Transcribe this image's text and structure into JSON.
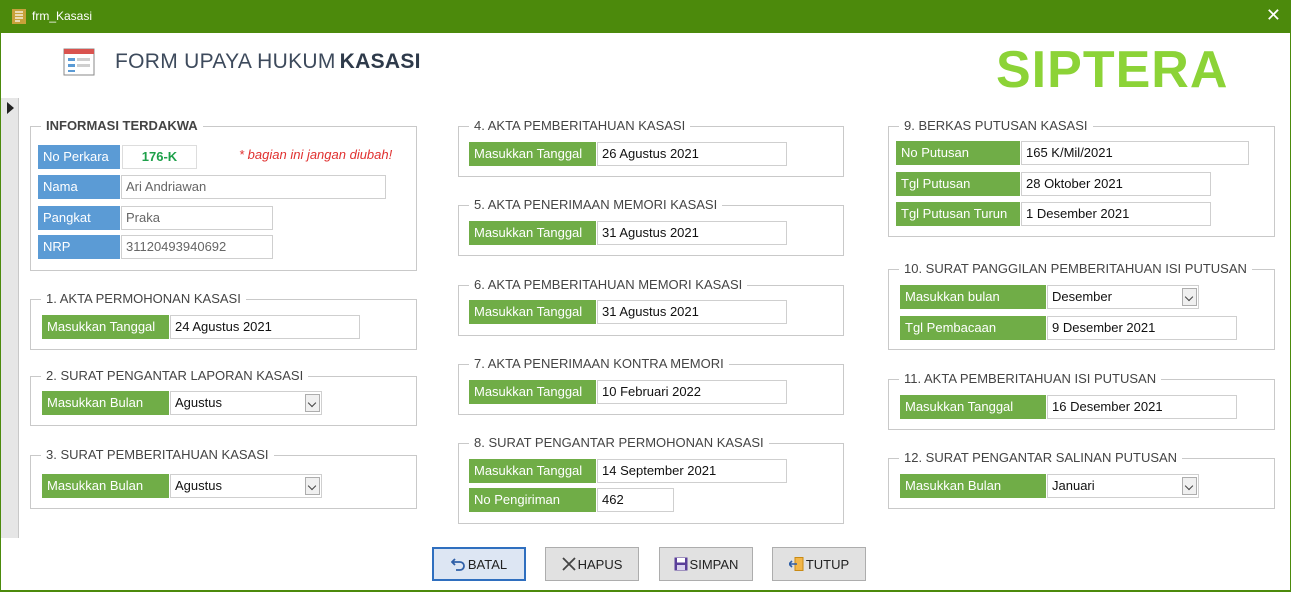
{
  "window": {
    "title": "frm_Kasasi"
  },
  "header": {
    "title_prefix": "FORM UPAYA HUKUM",
    "title_bold": "KASASI",
    "logo": "SIPTERA"
  },
  "terdakwa": {
    "title": "INFORMASI TERDAKWA",
    "note": "* bagian ini jangan diubah!",
    "no_perkara_label": "No Perkara",
    "no_perkara": "176-K",
    "nama_label": "Nama",
    "nama": "Ari Andriawan",
    "pangkat_label": "Pangkat",
    "pangkat": "Praka",
    "nrp_label": "NRP",
    "nrp": "31120493940692"
  },
  "s1": {
    "title": "1. AKTA PERMOHONAN KASASI",
    "label": "Masukkan Tanggal",
    "value": "24 Agustus 2021"
  },
  "s2": {
    "title": "2. SURAT PENGANTAR LAPORAN KASASI",
    "label": "Masukkan Bulan",
    "value": "Agustus"
  },
  "s3": {
    "title": "3. SURAT PEMBERITAHUAN KASASI",
    "label": "Masukkan Bulan",
    "value": "Agustus"
  },
  "s4": {
    "title": "4. AKTA PEMBERITAHUAN KASASI",
    "label": "Masukkan Tanggal",
    "value": "26 Agustus 2021"
  },
  "s5": {
    "title": "5. AKTA PENERIMAAN MEMORI KASASI",
    "label": "Masukkan Tanggal",
    "value": "31 Agustus 2021"
  },
  "s6": {
    "title": "6. AKTA PEMBERITAHUAN MEMORI KASASI",
    "label": "Masukkan Tanggal",
    "value": "31 Agustus 2021"
  },
  "s7": {
    "title": "7. AKTA PENERIMAAN KONTRA MEMORI",
    "label": "Masukkan Tanggal",
    "value": "10 Februari 2022"
  },
  "s8": {
    "title": "8. SURAT PENGANTAR PERMOHONAN KASASI",
    "label": "Masukkan Tanggal",
    "value": "14 September 2021",
    "label2": "No Pengiriman",
    "value2": "462"
  },
  "s9": {
    "title": "9. BERKAS PUTUSAN KASASI",
    "no_label": "No Putusan",
    "no_value": "165 K/Mil/2021",
    "tgl_label": "Tgl Putusan",
    "tgl_value": "28 Oktober 2021",
    "turun_label": "Tgl Putusan Turun",
    "turun_value": "1 Desember 2021"
  },
  "s10": {
    "title": "10. SURAT PANGGILAN PEMBERITAHUAN ISI PUTUSAN",
    "label": "Masukkan bulan",
    "value": "Desember",
    "label2": "Tgl Pembacaan",
    "value2": "9 Desember 2021"
  },
  "s11": {
    "title": "11. AKTA PEMBERITAHUAN ISI PUTUSAN",
    "label": "Masukkan Tanggal",
    "value": "16 Desember 2021"
  },
  "s12": {
    "title": "12. SURAT PENGANTAR SALINAN PUTUSAN",
    "label": "Masukkan Bulan",
    "value": "Januari"
  },
  "buttons": {
    "batal": "BATAL",
    "hapus": "HAPUS",
    "simpan": "SIMPAN",
    "tutup": "TUTUP"
  },
  "colors": {
    "titlebar": "#4c8a0c",
    "label_blue": "#5b9bd5",
    "label_green": "#70ad47",
    "logo": "#8cd337",
    "note": "#e0302f",
    "perkara": "#1ea04a"
  }
}
